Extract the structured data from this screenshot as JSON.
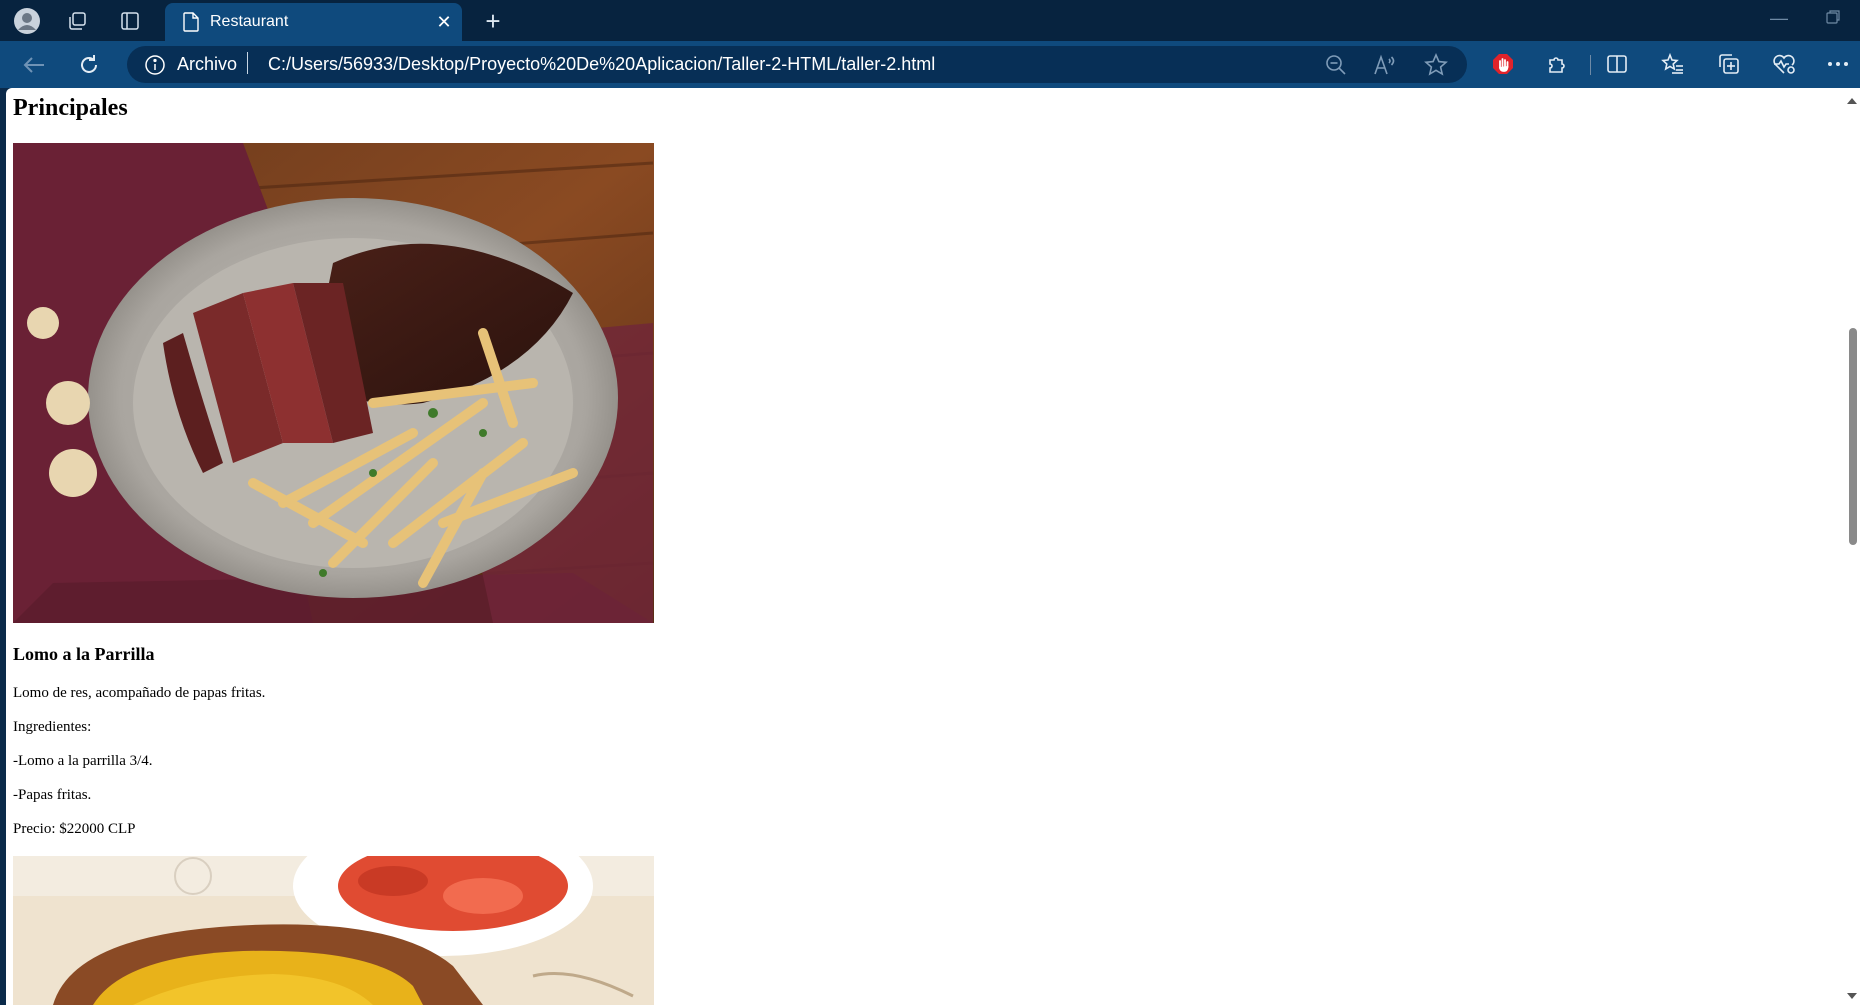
{
  "browser": {
    "tab": {
      "title": "Restaurant"
    },
    "address": {
      "scheme_label": "Archivo",
      "url": "C:/Users/56933/Desktop/Proyecto%20De%20Aplicacion/Taller-2-HTML/taller-2.html"
    }
  },
  "page": {
    "section_heading": "Principales",
    "dishes": [
      {
        "name": "Lomo a la Parrilla",
        "description": "Lomo de res, acompañado de papas fritas.",
        "ingredients_label": "Ingredientes:",
        "ingredients": [
          "-Lomo a la parrilla 3/4.",
          "-Papas fritas."
        ],
        "price": "Precio: $22000 CLP"
      }
    ]
  },
  "colors": {
    "titlebar_bg": "#07233f",
    "toolbar_bg": "#0f4a7d",
    "omnibox_bg": "#072f56",
    "page_bg": "#ffffff"
  },
  "icons": [
    "profile-icon",
    "workspaces-icon",
    "tab-actions-icon",
    "page-icon",
    "close-icon",
    "plus-icon",
    "minimize-icon",
    "restore-icon",
    "back-icon",
    "refresh-icon",
    "info-icon",
    "zoom-out-icon",
    "read-aloud-icon",
    "favorite-star-icon",
    "adblock-hand-icon",
    "extensions-icon",
    "split-screen-icon",
    "favorites-icon",
    "collections-icon",
    "performance-icon",
    "more-icon"
  ]
}
